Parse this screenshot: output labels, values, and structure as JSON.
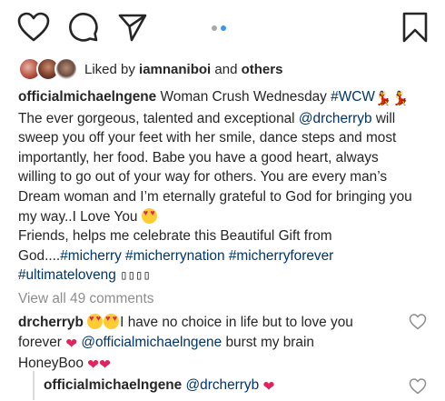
{
  "liked": {
    "prefix": "Liked by",
    "user": "iamnaniboi",
    "conjunction": "and",
    "others": "others"
  },
  "caption": {
    "user": "officialmichaelngene",
    "l1_text": "Woman Crush Wednesday",
    "l1_tag": "#WCW",
    "l2_pre": "The ever gorgeous, talented and exceptional",
    "l2_mention": "@drcherryb",
    "l2_post": "will",
    "l3": "sweep you off your feet with her smile, dance steps and most",
    "l4": "importantly, her food. Babe you have a good heart, always",
    "l5": "willing to go out of your way for others. You are every man’s",
    "l6": "Dream woman and I’m eternally grateful to God for bringing you",
    "l7": "my way..I Love You",
    "l8": "Friends, helps me celebrate this Beautiful Gift from",
    "l9_pre": "God....",
    "tag_micherry": "#micherry",
    "tag_micherrynation": "#micherrynation",
    "tag_micherryforever": "#micherryforever",
    "tag_ultimateloveng": "#ultimateloveng",
    "tail_boxes": "▯▯▯▯"
  },
  "view_all": "View all 49 comments",
  "comment": {
    "user": "drcherryb",
    "text1": "I have no choice in life but to love you",
    "text2_pre": "forever",
    "mention": "@officialmichaelngene",
    "text2_post": "burst my brain",
    "text3": "HoneyBoo"
  },
  "reply": {
    "user": "officialmichaelngene",
    "mention": "@drcherryb"
  },
  "icons": {
    "like": "heart-outline-icon",
    "comment": "comment-bubble-icon",
    "share": "paper-plane-icon",
    "save": "bookmark-icon"
  },
  "colors": {
    "text": "#262626",
    "link": "#003569",
    "muted": "#8e8e8e",
    "active_dot": "#3897f0",
    "heart": "#e0245e"
  }
}
